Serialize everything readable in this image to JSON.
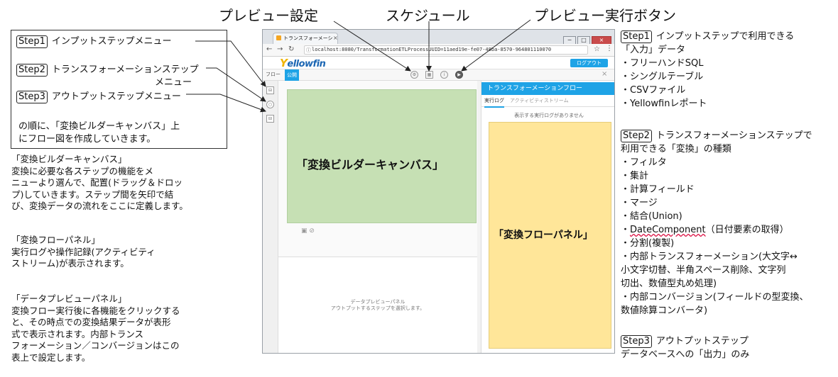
{
  "callouts": {
    "preview_settings": "プレビュー設定",
    "schedule": "スケジュール",
    "preview_run_button": "プレビュー実行ボタン"
  },
  "left_box": {
    "step1_tag": "Step1",
    "step1_text": "インプットステップメニュー",
    "step2_tag": "Step2",
    "step2_text": "トランスフォーメーションステップ",
    "step2_text2": "メニュー",
    "step3_tag": "Step3",
    "step3_text": "アウトプットステップメニュー",
    "footer_line1": "の順に、「変換ビルダーキャンバス」上",
    "footer_line2": "にフロー図を作成していきます。"
  },
  "left_desc": {
    "canvas": "「変換ビルダーキャンバス」\n変換に必要な各ステップの機能をメ\nニューより選んで、配置(ドラッグ＆ドロッ\nプ)していきます。ステップ間を矢印で結\nび、変換データの流れをここに定義します。",
    "flow_panel": "「変換フローパネル」\n実行ログや操作記録(アクティビティ\nストリーム)が表示されます。",
    "preview_panel": "「データプレビューパネル」\n変換フロー実行後に各機能をクリックする\nと、その時点での変換結果データが表形\n式で表示されます。内部トランス\nフォーメーション／コンバージョンはこの\n表上で設定します。"
  },
  "browser": {
    "tab_title": "トランスフォーメーシ",
    "tab_close": "×",
    "win_min": "─",
    "win_max": "□",
    "win_close": "×",
    "url": "localhost:8080/TransformationETLProcessUUID=11aed19e-fe07-48ba-8570-964801110070",
    "logo_y": "Y",
    "logo_rest": "ellowfin",
    "logout_label": "ログアウト",
    "toolbar_flow": "フロー",
    "toolbar_public": "公開",
    "canvas_label": "「変換ビルダーキャンバス」",
    "preview_placeholder1": "データプレビューパネル",
    "preview_placeholder2": "アウトプットするステップを選択します。",
    "flow_title": "トランスフォーメーションフロー",
    "flow_tab_log": "実行ログ",
    "flow_tab_activity": "アクティビティストリーム",
    "flow_no_log": "表示する実行ログがありません",
    "flow_label": "「変換フローパネル」"
  },
  "right": {
    "step1_tag": "Step1",
    "step1_title": "インプットステップで利用できる",
    "step1_title2": "「入力」データ",
    "step1_items": [
      "・フリーハンドSQL",
      "・シングルテーブル",
      "・CSVファイル",
      "・Yellowfinレポート"
    ],
    "step2_tag": "Step2",
    "step2_title": "トランスフォーメーションステップで",
    "step2_title2": "利用できる「変換」の種類",
    "step2_items": [
      "・フィルタ",
      "・集計",
      "・計算フィールド",
      "・マージ",
      "・結合(Union)"
    ],
    "step2_datecomp": "DateComponent",
    "step2_datecomp_rest": "（日付要素の取得）",
    "step2_items2": [
      "・分割(複製)",
      "・内部トランスフォーメーション(大文字↔",
      "小文字切替、半角スペース削除、文字列",
      "切出、数値型丸め処理)",
      "・内部コンバージョン(フィールドの型変換、",
      "数値除算コンバータ)"
    ],
    "step3_tag": "Step3",
    "step3_title": "アウトプットステップ",
    "step3_title2": "データベースへの「出力」のみ"
  }
}
